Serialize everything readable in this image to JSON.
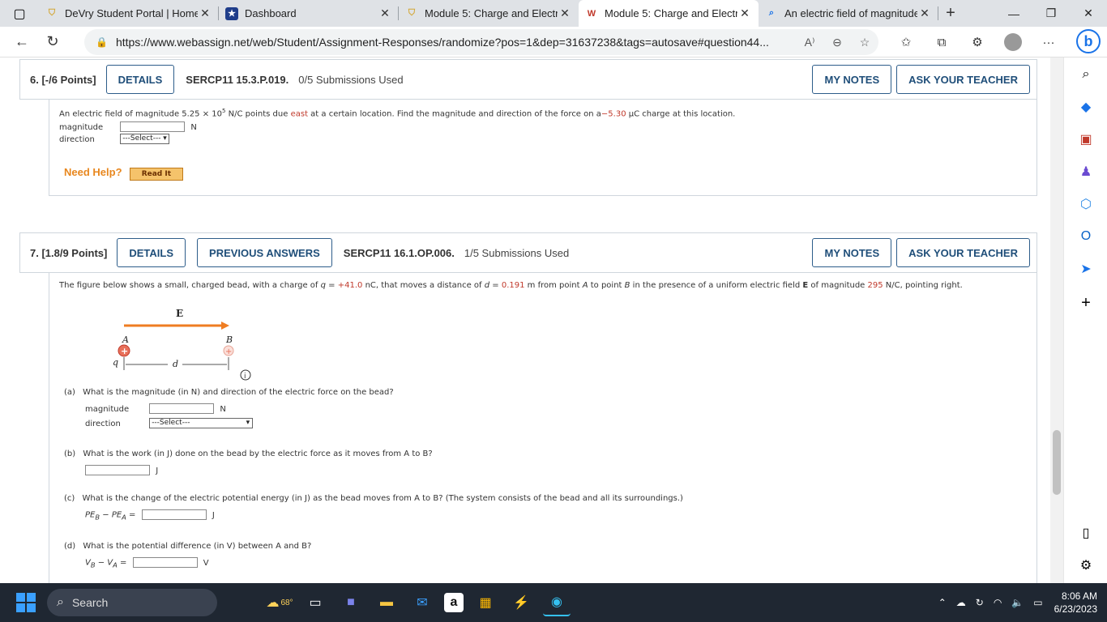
{
  "browser": {
    "tabs": [
      {
        "title": "DeVry Student Portal | Home",
        "favicon": "shield"
      },
      {
        "title": "Dashboard",
        "favicon": "star"
      },
      {
        "title": "Module 5: Charge and Electric",
        "favicon": "shield"
      },
      {
        "title": "Module 5: Charge and Electric",
        "favicon": "wa"
      },
      {
        "title": "An electric field of magnitude",
        "favicon": "search"
      }
    ],
    "active_tab": 3,
    "url": "https://www.webassign.net/web/Student/Assignment-Responses/randomize?pos=1&dep=31637238&tags=autosave#question44..."
  },
  "q6": {
    "number": "6.  [-/6 Points]",
    "details": "DETAILS",
    "code": "SERCP11 15.3.P.019.",
    "submissions": "0/5 Submissions Used",
    "my_notes": "MY NOTES",
    "ask_teacher": "ASK YOUR TEACHER",
    "text_a": "An electric field of magnitude 5.25 × 10",
    "exp": "5",
    "text_b": " N/C points due ",
    "east": "east",
    "text_c": " at a certain location. Find the magnitude and direction of the force on a",
    "charge": "−5.30",
    "text_d": " μC charge at this location.",
    "magnitude_label": "magnitude",
    "unit_N": "N",
    "direction_label": "direction",
    "select": "---Select---",
    "need_help": "Need Help?",
    "read_it": "Read It"
  },
  "q7": {
    "number": "7.  [1.8/9 Points]",
    "details": "DETAILS",
    "previous": "PREVIOUS ANSWERS",
    "code": "SERCP11 16.1.OP.006.",
    "submissions": "1/5 Submissions Used",
    "my_notes": "MY NOTES",
    "ask_teacher": "ASK YOUR TEACHER",
    "intro_a": "The figure below shows a small, charged bead, with a charge of ",
    "q_eq": "q = ",
    "q_val": "+41.0",
    "intro_b": " nC, that moves a distance of ",
    "d_eq": "d = ",
    "d_val": "0.191",
    "intro_c": " m from point ",
    "A": "A",
    "intro_d": " to point ",
    "B": "B",
    "intro_e": " in the presence of a uniform electric field ",
    "E": "E",
    "intro_f": " of magnitude ",
    "E_val": "295",
    "intro_g": " N/C, pointing right.",
    "fig": {
      "E": "E",
      "A": "A",
      "B": "B",
      "q": "q",
      "d": "d"
    },
    "parts": {
      "a_tag": "(a)",
      "a_text": "What is the magnitude (in N) and direction of the electric force on the bead?",
      "magnitude": "magnitude",
      "unit_N": "N",
      "direction": "direction",
      "select": "---Select---",
      "b_tag": "(b)",
      "b_text": "What is the work (in J) done on the bead by the electric force as it moves from A to B?",
      "unit_J": "J",
      "c_tag": "(c)",
      "c_text": "What is the change of the electric potential energy (in J) as the bead moves from A to B? (The system consists of the bead and all its surroundings.)",
      "c_lhs": "PE",
      "c_sub1": "B",
      "c_mid": " − PE",
      "c_sub2": "A",
      "c_eq": " =",
      "d_tag": "(d)",
      "d_text": "What is the potential difference (in V) between A and B?",
      "d_lhs": "V",
      "d_sub1": "B",
      "d_mid": " − V",
      "d_sub2": "A",
      "d_eq": " =",
      "unit_V": "V"
    }
  },
  "taskbar": {
    "search": "Search",
    "weather": "68°",
    "time": "8:06 AM",
    "date": "6/23/2023"
  },
  "colors": {
    "accent_red": "#c0392b",
    "orange": "#e8871e",
    "button_border": "#2d5d8a"
  }
}
